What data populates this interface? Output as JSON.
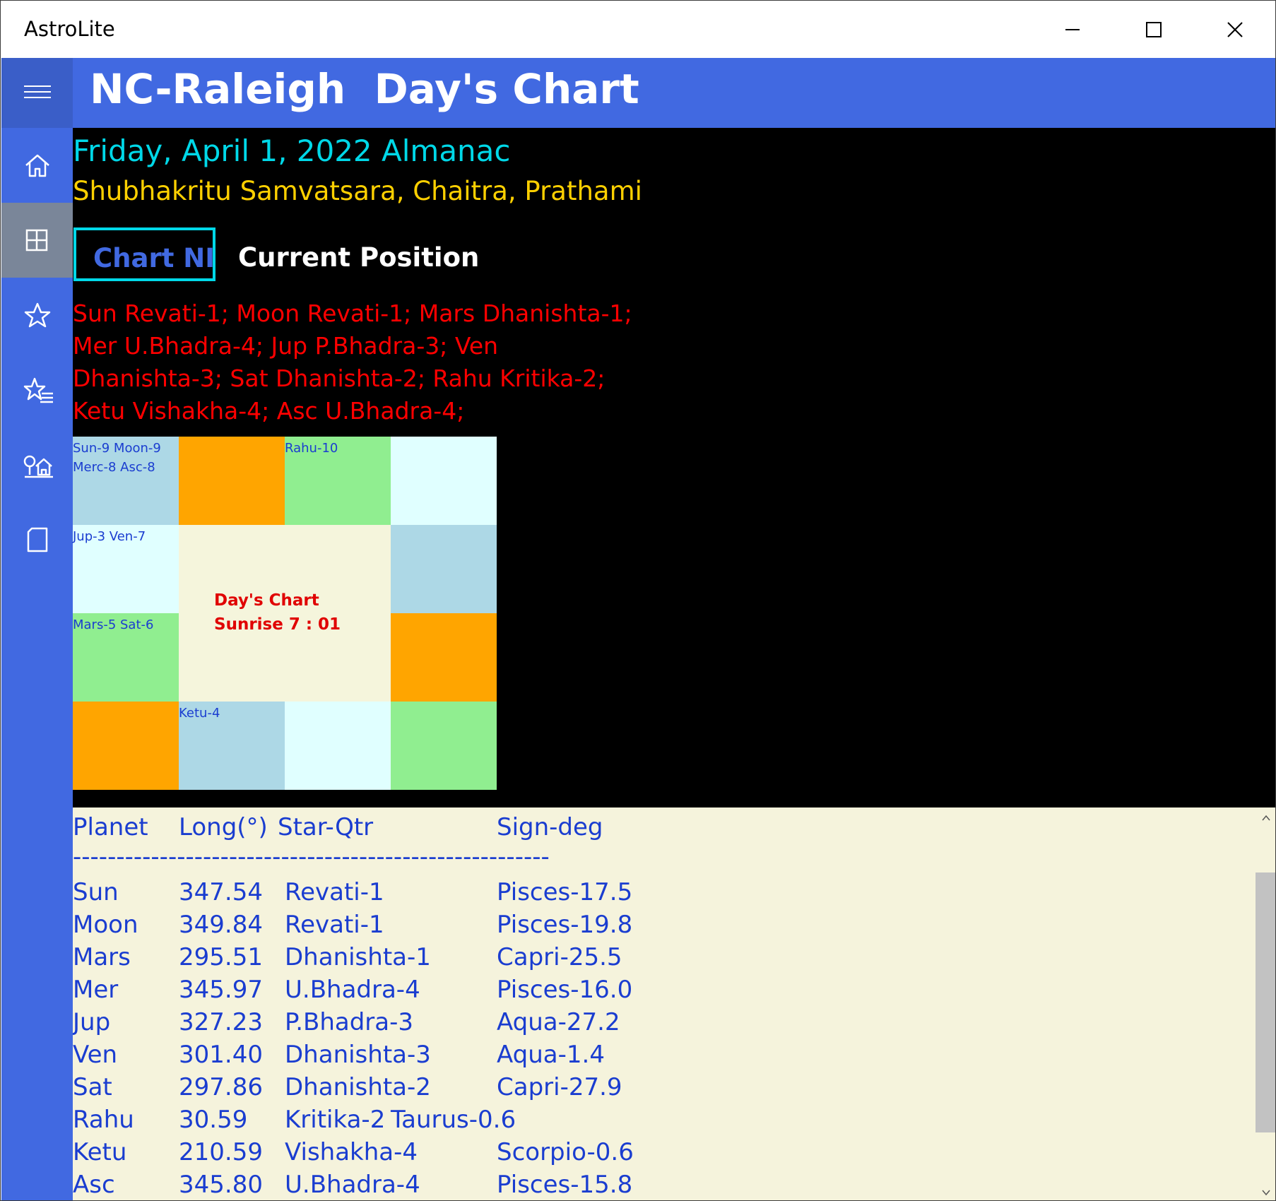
{
  "window": {
    "title": "AstroLite",
    "controls": {
      "minimize": "minimize-icon",
      "maximize": "maximize-icon",
      "close": "close-icon"
    }
  },
  "sidebar": {
    "items": [
      {
        "icon": "hamburger-menu-icon"
      },
      {
        "icon": "home-icon"
      },
      {
        "icon": "grid-icon",
        "selected": true
      },
      {
        "icon": "star-icon"
      },
      {
        "icon": "star-list-icon"
      },
      {
        "icon": "tree-house-icon"
      },
      {
        "icon": "page-icon"
      }
    ]
  },
  "header": {
    "title": "NC-Raleigh  Day's Chart"
  },
  "almanac": {
    "date_line": "Friday, April 1, 2022 Almanac",
    "samvat_line": "Shubhakritu Samvatsara, Chaitra, Prathami"
  },
  "tabs": {
    "chart_ni": "Chart NI",
    "current_position": "Current Position"
  },
  "positions_text": [
    "Sun Revati-1; Moon Revati-1; Mars Dhanishta-1;",
    "Mer U.Bhadra-4; Jup P.Bhadra-3; Ven",
    "Dhanishta-3; Sat Dhanishta-2; Rahu Kritika-2;",
    "Ketu Vishakha-4; Asc U.Bhadra-4;"
  ],
  "chart": {
    "cells": {
      "pisces": [
        "Sun-9 Moon-9",
        "Merc-8 Asc-8"
      ],
      "taurus": [
        "Rahu-10"
      ],
      "aquarius": [
        "Jup-3 Ven-7"
      ],
      "capricorn": [
        "Mars-5 Sat-6"
      ],
      "scorpio": [
        "Ketu-4"
      ]
    },
    "center": {
      "line1": "Day's Chart",
      "line2": "Sunrise 7 : 01"
    }
  },
  "table": {
    "headers": [
      "Planet",
      "Long(°)",
      "Star-Qtr",
      "Sign-deg"
    ],
    "rule": "-------------------------------------------------------",
    "rows": [
      {
        "planet": "Sun",
        "long": "347.54",
        "star": "Revati-1",
        "sign": "Pisces-17.5"
      },
      {
        "planet": "Moon",
        "long": "349.84",
        "star": "Revati-1",
        "sign": "Pisces-19.8"
      },
      {
        "planet": "Mars",
        "long": "295.51",
        "star": "Dhanishta-1",
        "sign": "Capri-25.5"
      },
      {
        "planet": "Mer",
        "long": "345.97",
        "star": "U.Bhadra-4",
        "sign": "Pisces-16.0"
      },
      {
        "planet": "Jup",
        "long": "327.23",
        "star": "P.Bhadra-3",
        "sign": "Aqua-27.2"
      },
      {
        "planet": "Ven",
        "long": "301.40",
        "star": "Dhanishta-3",
        "sign": "Aqua-1.4"
      },
      {
        "planet": "Sat",
        "long": "297.86",
        "star": "Dhanishta-2",
        "sign": "Capri-27.9"
      },
      {
        "planet": "Rahu",
        "long": "30.59",
        "star": "Kritika-2",
        "sign": "Taurus-0.6"
      },
      {
        "planet": "Ketu",
        "long": "210.59",
        "star": "Vishakha-4",
        "sign": "Scorpio-0.6"
      },
      {
        "planet": "Asc",
        "long": "345.80",
        "star": "U.Bhadra-4",
        "sign": "Pisces-15.8"
      }
    ]
  },
  "colors": {
    "accent_blue": "#4169e1",
    "sidebar_selected": "#7a8699",
    "cyan_text": "#00d8e8",
    "yellow_text": "#ffd000",
    "red_text": "#ff0000",
    "table_text": "#1a3dd0",
    "table_bg": "#f5f3dc",
    "cell_lightblue": "#add8e6",
    "cell_orange": "#ffa500",
    "cell_green": "#90ee90",
    "cell_cyan": "#e0ffff",
    "cell_beige": "#f5f5dc"
  }
}
